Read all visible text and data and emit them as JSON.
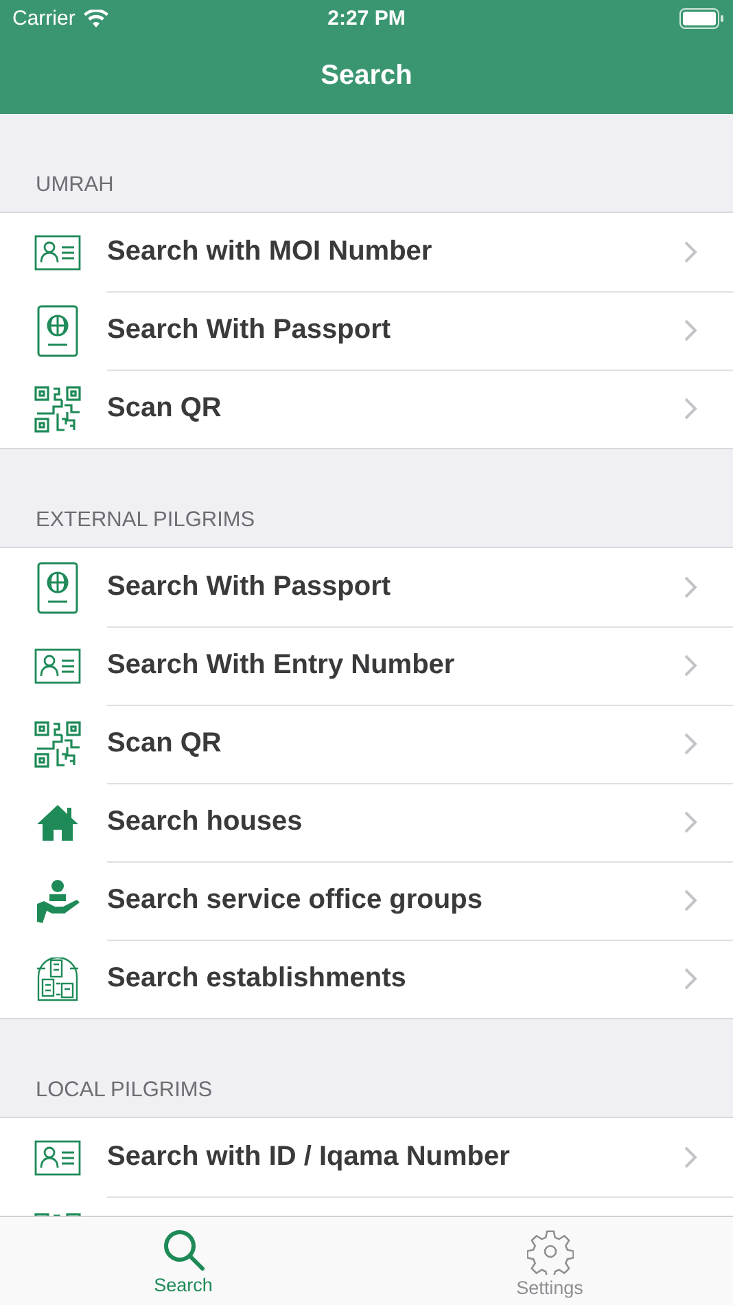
{
  "status_bar": {
    "carrier": "Carrier",
    "time": "2:27 PM"
  },
  "nav_bar": {
    "title": "Search"
  },
  "sections": [
    {
      "header": "UMRAH",
      "rows": [
        {
          "kind": "idcard",
          "label": "Search with MOI Number"
        },
        {
          "kind": "passport",
          "label": "Search With Passport"
        },
        {
          "kind": "qr",
          "label": "Scan QR"
        }
      ]
    },
    {
      "header": "EXTERNAL PILGRIMS",
      "rows": [
        {
          "kind": "passport",
          "label": "Search With Passport"
        },
        {
          "kind": "idcard",
          "label": "Search With Entry Number"
        },
        {
          "kind": "qr",
          "label": "Scan QR"
        },
        {
          "kind": "house",
          "label": "Search houses"
        },
        {
          "kind": "service",
          "label": "Search service office groups"
        },
        {
          "kind": "establishment",
          "label": "Search establishments"
        }
      ]
    },
    {
      "header": "LOCAL PILGRIMS",
      "rows": [
        {
          "kind": "idcard",
          "label": "Search with ID / Iqama Number"
        },
        {
          "kind": "qr"
        }
      ]
    }
  ],
  "tab_bar": [
    {
      "kind": "search",
      "label": "Search",
      "selected": true
    },
    {
      "kind": "settings",
      "label": "Settings",
      "selected": false
    }
  ]
}
